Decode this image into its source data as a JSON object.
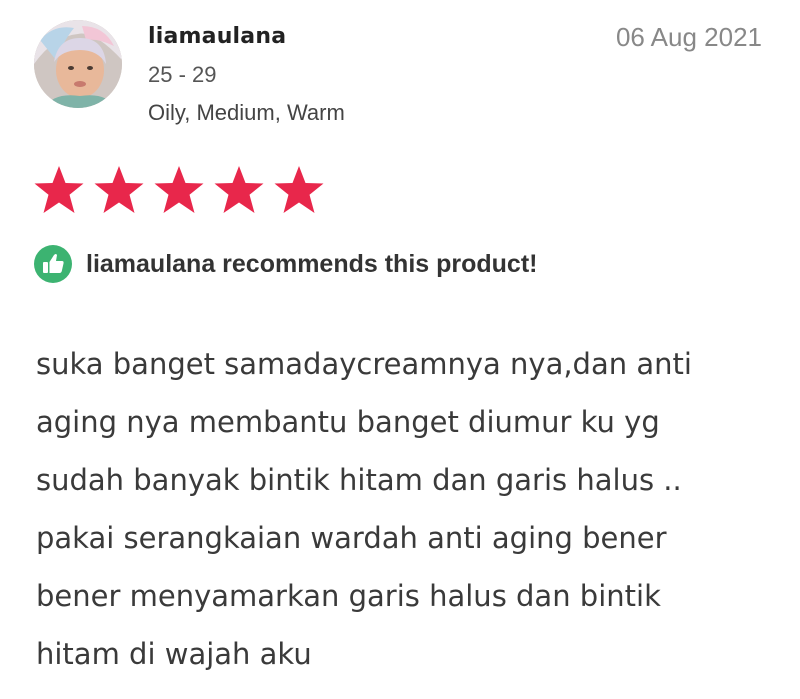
{
  "review": {
    "username": "liamaulana",
    "age_range": "25 - 29",
    "skin_profile": "Oily, Medium, Warm",
    "date": "06 Aug 2021",
    "rating": 5,
    "rating_max": 5,
    "star_color": "#e8274b",
    "recommend_icon": "thumbs-up-icon",
    "recommend_color": "#3cb371",
    "recommend_text": "liamaulana recommends this product!",
    "body_lines": [
      "suka banget samadaycreamnya nya,dan anti",
      "aging nya membantu banget diumur ku yg",
      "sudah banyak bintik hitam dan garis halus ..",
      "pakai serangkaian wardah anti aging bener",
      "bener menyamarkan garis halus dan bintik",
      "hitam di wajah aku"
    ]
  }
}
